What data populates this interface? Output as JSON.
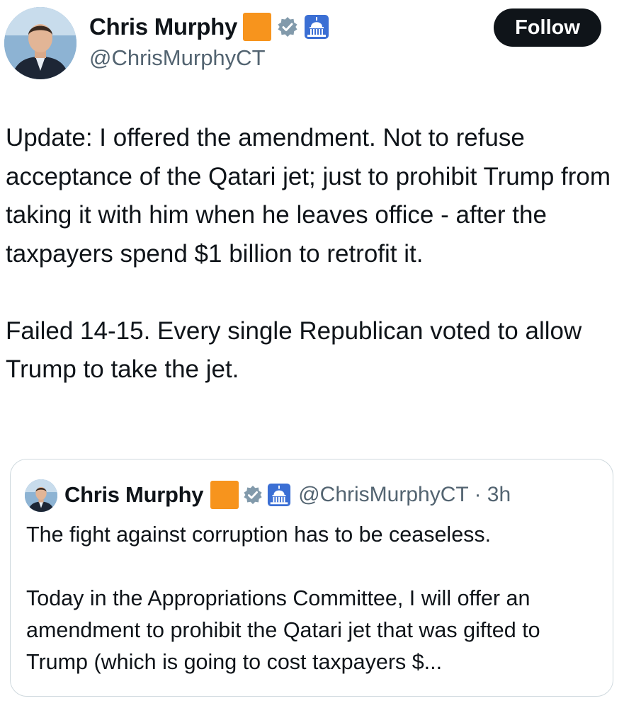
{
  "author": {
    "name": "Chris Murphy",
    "handle": "@ChrisMurphyCT",
    "badges": [
      "orange-square",
      "verified-badge-icon",
      "capitol-icon"
    ]
  },
  "follow_label": "Follow",
  "tweet": {
    "text": "Update: I offered the amendment. Not to refuse acceptance of the Qatari jet; just to prohibit Trump from taking it with him when he leaves office - after the taxpayers spend $1 billion to retrofit it.\n\nFailed 14-15. Every single Republican voted to allow Trump to take the jet."
  },
  "quoted_tweet": {
    "name": "Chris Murphy",
    "handle_time": "@ChrisMurphyCT · 3h",
    "text": "The fight against corruption has to be ceaseless.\n\nToday in the Appropriations Committee, I will offer an amendment to prohibit the Qatari jet that was gifted to Trump (which is going to cost taxpayers $..."
  },
  "colors": {
    "text": "#0f1419",
    "secondary": "#536471",
    "orange": "#f7941d",
    "verified": "#829aab",
    "capitol": "#3b6fd4",
    "border": "#cfd9de"
  }
}
